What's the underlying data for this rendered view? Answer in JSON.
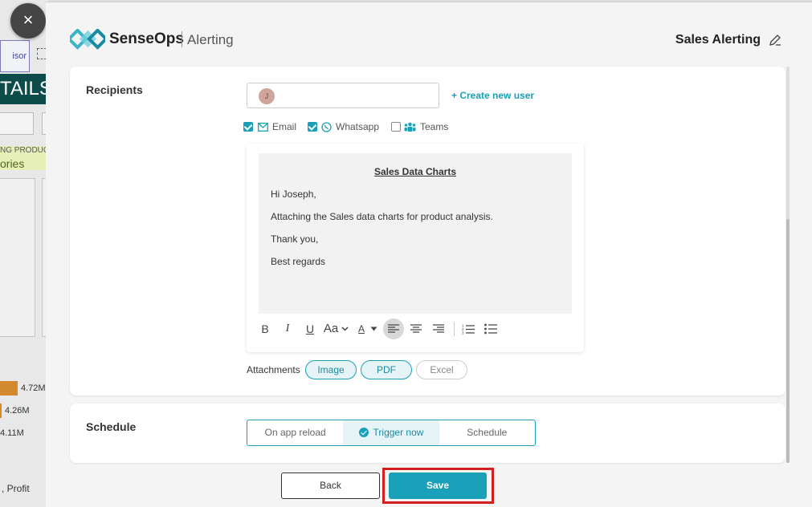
{
  "background_app": {
    "tab_text": "isor",
    "banner_text": "TAILS",
    "product_header": "NG PRODUCT",
    "product_value": "ories",
    "bar_values": [
      "4.72M",
      "4.26M",
      "4.11M"
    ],
    "footer_text": ", Profit"
  },
  "header": {
    "brand": "SenseOps",
    "brand_sub": "Alerting",
    "title": "Sales Alerting"
  },
  "recipients": {
    "label": "Recipients",
    "avatar_initial": "J",
    "create_user": "+ Create new user",
    "channels": [
      {
        "label": "Email",
        "checked": true,
        "icon": "mail-icon"
      },
      {
        "label": "Whatsapp",
        "checked": true,
        "icon": "whatsapp-icon"
      },
      {
        "label": "Teams",
        "checked": false,
        "icon": "teams-icon"
      }
    ],
    "message": {
      "subject": "Sales Data Charts",
      "lines": [
        "Hi Joseph,",
        "Attaching the Sales data charts for product analysis.",
        "Thank you,",
        "Best regards"
      ]
    },
    "toolbar": {
      "bold": "B",
      "italic": "I",
      "underline": "U",
      "font_size": "Aa",
      "font_color": "A"
    },
    "attachments_label": "Attachments",
    "attachments": [
      {
        "label": "Image",
        "selected": true
      },
      {
        "label": "PDF",
        "selected": true
      },
      {
        "label": "Excel",
        "selected": false
      }
    ]
  },
  "schedule": {
    "label": "Schedule",
    "options": [
      {
        "label": "On app reload",
        "selected": false
      },
      {
        "label": "Trigger now",
        "selected": true
      },
      {
        "label": "Schedule",
        "selected": false
      }
    ]
  },
  "footer": {
    "back": "Back",
    "save": "Save"
  },
  "colors": {
    "accent": "#1aa0b8",
    "highlight": "#d21f1f",
    "banner": "#0d4c4a"
  }
}
